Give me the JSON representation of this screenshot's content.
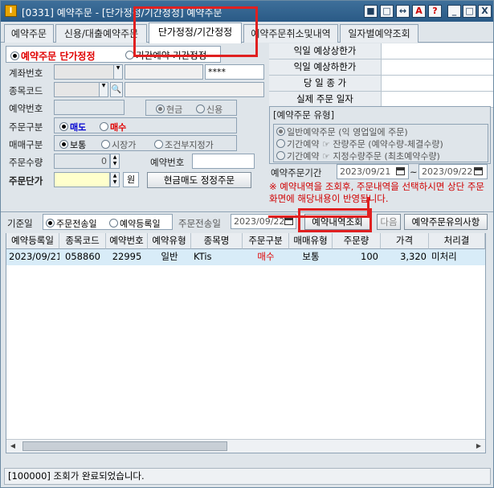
{
  "titlebar": {
    "app_icon": "I",
    "title": "[0331] 예약주문 - [단가정정/기간정정] 예약주문",
    "buttons": [
      "■",
      "□",
      "↔",
      "A",
      "?",
      "_",
      "□",
      "X"
    ]
  },
  "tabs": [
    {
      "label": "예약주문"
    },
    {
      "label": "신용/대출예약주문"
    },
    {
      "label": "단가정정/기간정정"
    },
    {
      "label": "예약주문취소및내역"
    },
    {
      "label": "일자별예약조회"
    }
  ],
  "mode_group": {
    "option1": "예약주문 단가정정",
    "option2": "기간예약 기간정정"
  },
  "form": {
    "account_label": "계좌번호",
    "account_value": "",
    "password_value": "****",
    "stock_label": "종목코드",
    "reserve_no_label": "예약번호",
    "cash_label": "현금",
    "credit_label": "신용",
    "order_type_label": "주문구분",
    "sell_label": "매도",
    "buy_label": "매수",
    "trade_type_label": "매매구분",
    "normal_label": "보통",
    "market_label": "시장가",
    "conditional_label": "조건부지정가",
    "qty_label": "주문수량",
    "qty_value": "0",
    "reserve_no2_label": "예약번호",
    "price_label": "주문단가",
    "won_label": "원",
    "submit_button": "현금매도 정정주문"
  },
  "right_table": [
    {
      "label": "익일 예상상한가",
      "value": ""
    },
    {
      "label": "익일 예상하한가",
      "value": ""
    },
    {
      "label": "당 일 종 가",
      "value": ""
    },
    {
      "label": "실제 주문 일자",
      "value": ""
    }
  ],
  "reserve_type": {
    "title": "[예약주문 유형]",
    "opt1": "일반예약주문 (익 영업일에 주문)",
    "opt2": "기간예약 ☞ 잔량주문 (예약수량-체결수량)",
    "opt3": "기간예약 ☞ 지정수량주문 (최초예약수량)"
  },
  "period": {
    "label": "예약주문기간",
    "from": "2023/09/21",
    "sep": "~",
    "to": "2023/09/22"
  },
  "notice": "※ 예약내역을 조회후, 주문내역을 선택하시면 상단 주문화면에 해당내용이 반영됩니다.",
  "query_bar": {
    "base_label": "기준일",
    "opt_send": "주문전송일",
    "opt_reg": "예약등록일",
    "send_date_label": "주문전송일",
    "send_date": "2023/09/22",
    "query_button": "예약내역조회",
    "next_button": "다음",
    "notice_button": "예약주문유의사항"
  },
  "grid": {
    "columns": [
      "예약등록일",
      "종목코드",
      "예약번호",
      "예약유형",
      "종목명",
      "주문구분",
      "매매유형",
      "주문량",
      "가격",
      "처리결"
    ],
    "rows": [
      [
        "2023/09/21",
        "058860",
        "22995",
        "일반",
        "KTis",
        "매수",
        "보통",
        "100",
        "3,320",
        "미처리"
      ]
    ]
  },
  "status": "[100000] 조회가 완료되었습니다.",
  "colors": {
    "sell": "#0000d0",
    "buy": "#e00000",
    "notice": "#d00000",
    "highlight": "#e02020"
  }
}
